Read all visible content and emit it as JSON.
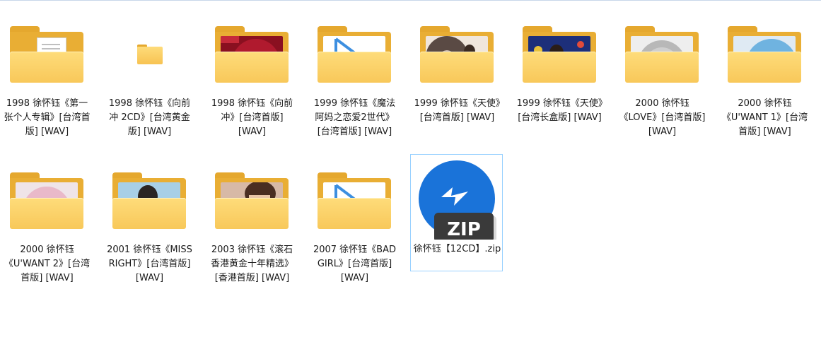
{
  "items": [
    {
      "label": "1998 徐怀钰《第一张个人专辑》[台湾首版] [WAV]",
      "icon": "folder-doc-icon"
    },
    {
      "label": "1998 徐怀钰《向前冲 2CD》[台湾黄金版] [WAV]",
      "icon": "folder-small-icon"
    },
    {
      "label": "1998 徐怀钰《向前冲》[台湾首版] [WAV]",
      "icon": "folder-cd-red-icon"
    },
    {
      "label": "1999 徐怀钰《魔法阿妈之恋爱2世代》[台湾首版] [WAV]",
      "icon": "folder-media-icon"
    },
    {
      "label": "1999 徐怀钰《天使》[台湾首版] [WAV]",
      "icon": "folder-photo-icon"
    },
    {
      "label": "1999 徐怀钰《天使》[台湾长盒版] [WAV]",
      "icon": "folder-photo-icon"
    },
    {
      "label": "2000 徐怀钰《LOVE》[台湾首版] [WAV]",
      "icon": "folder-cd-pink-icon"
    },
    {
      "label": "2000 徐怀钰《U'WANT 1》[台湾首版] [WAV]",
      "icon": "folder-cd-blue-icon"
    },
    {
      "label": "2000 徐怀钰《U'WANT 2》[台湾首版] [WAV]",
      "icon": "folder-cd-rose-icon"
    },
    {
      "label": "2001 徐怀钰《MISS RIGHT》[台湾首版] [WAV]",
      "icon": "folder-photo-icon"
    },
    {
      "label": "2003 徐怀钰《滚石香港黄金十年精选》[香港首版] [WAV]",
      "icon": "folder-photo-icon"
    },
    {
      "label": "2007 徐怀钰《BAD GIRL》[台湾首版] [WAV]",
      "icon": "folder-media-icon"
    },
    {
      "label": "徐怀钰【12CD】.zip",
      "icon": "zip-archive-icon",
      "selected": true
    }
  ],
  "zip_badge": "ZIP",
  "colors": {
    "selection_border": "#99d1ff",
    "folder_front": "#fdd266",
    "folder_back": "#e9ae34",
    "zip_blue": "#1a73d9"
  }
}
